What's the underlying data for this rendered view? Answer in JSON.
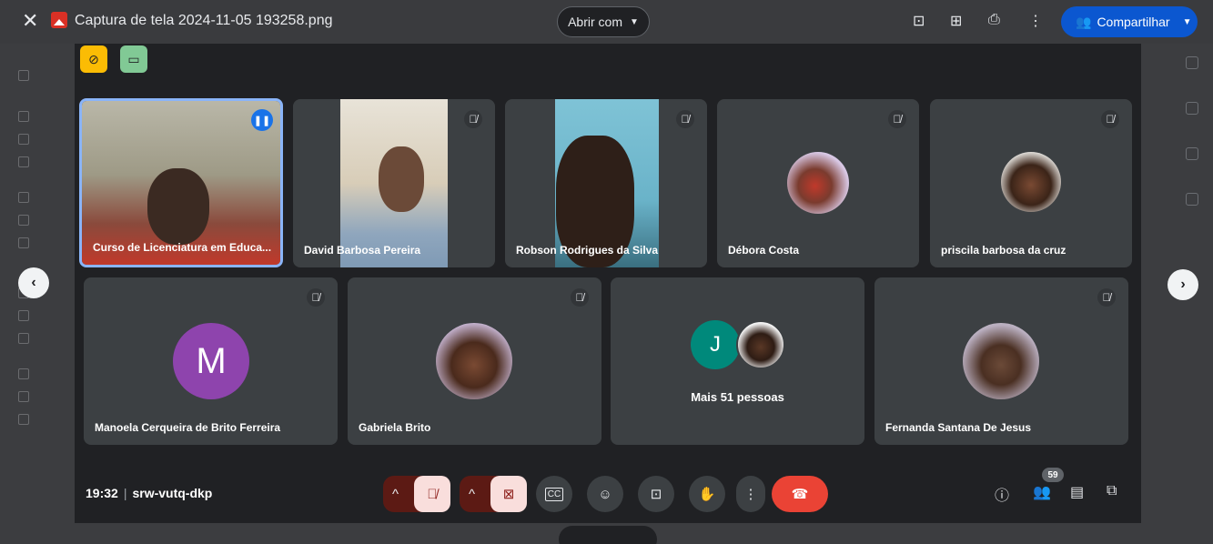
{
  "viewer": {
    "file_title": "Captura de tela 2024-11-05 193258.png",
    "open_with_label": "Abrir com",
    "share_label": "Compartilhar"
  },
  "meet": {
    "time": "19:32",
    "meeting_code": "srw-vutq-dkp",
    "participant_count": "59",
    "more_people_label": "Mais 51 pessoas",
    "more_people_initial": "J",
    "participants": [
      {
        "name": "Curso de Licenciatura em Educa...",
        "speaking": true
      },
      {
        "name": "David Barbosa Pereira",
        "muted": true
      },
      {
        "name": "Robson Rodrigues da Silva",
        "muted": true
      },
      {
        "name": "Débora Costa",
        "muted": true
      },
      {
        "name": "priscila barbosa da cruz",
        "muted": true
      },
      {
        "name": "Manoela Cerqueira de Brito Ferreira",
        "initial": "M",
        "muted": true
      },
      {
        "name": "Gabriela Brito",
        "muted": true
      },
      {
        "name": "Fernanda Santana De Jesus",
        "muted": true
      }
    ]
  },
  "colors": {
    "accent": "#8ab4f8",
    "share_button": "#0b57d0",
    "end_call": "#ea4335",
    "tile_bg": "#3c4043",
    "avatar_m": "#8e44ad",
    "avatar_j": "#00897b"
  }
}
